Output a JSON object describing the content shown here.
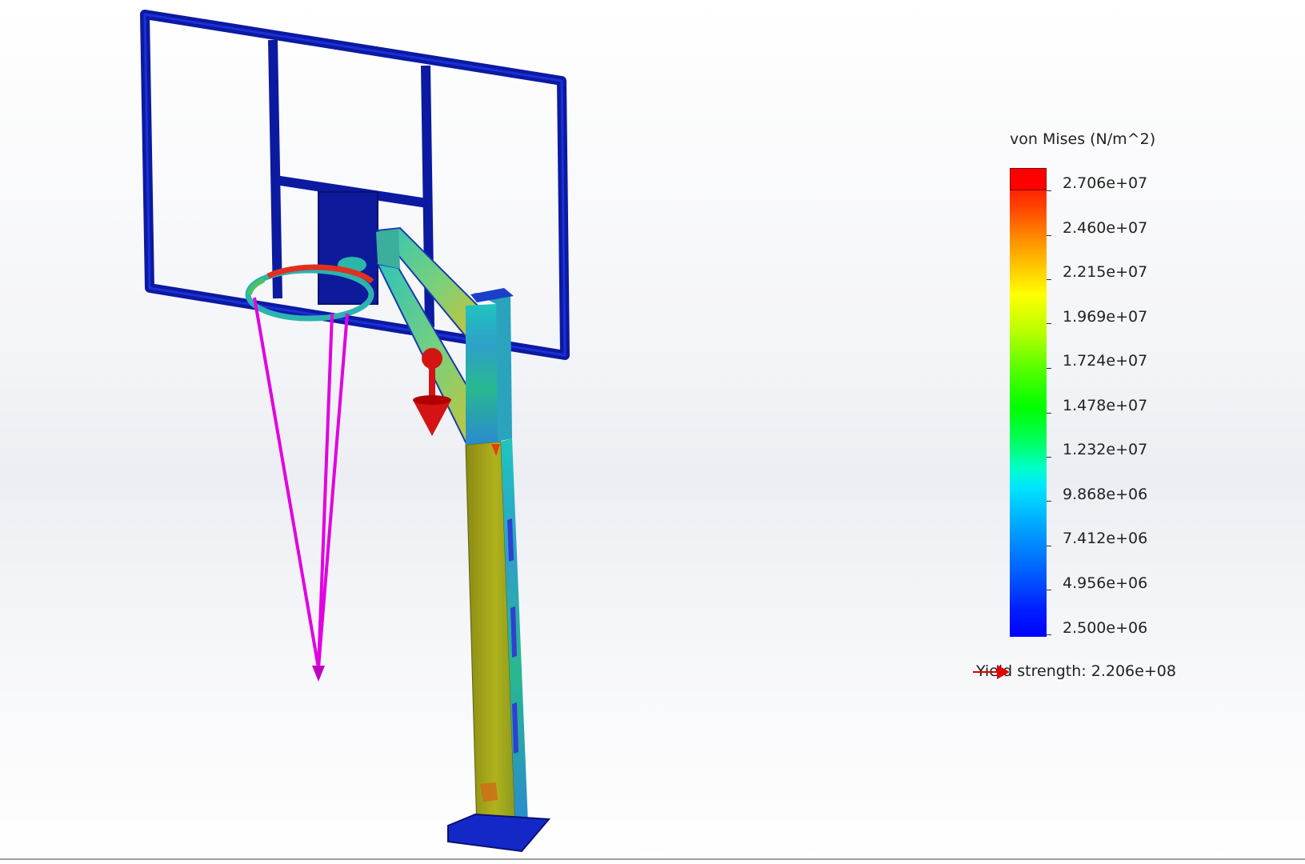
{
  "plot": {
    "title": "von Mises (N/m^2)",
    "max_color": "#ff0000",
    "min_color": "#0000ff",
    "ticks": [
      "2.706e+07",
      "2.460e+07",
      "2.215e+07",
      "1.969e+07",
      "1.724e+07",
      "1.478e+07",
      "1.232e+07",
      "9.868e+06",
      "7.412e+06",
      "4.956e+06",
      "2.500e+06"
    ],
    "yield_label": "Yield strength: 2.206e+08",
    "yield_arrow_color": "#e00000"
  },
  "model": {
    "name": "basketball-hoop-stand",
    "load_arrow_color": "#d01010",
    "net_color": "#e000e0",
    "frame_color": "#0a1a9c"
  }
}
